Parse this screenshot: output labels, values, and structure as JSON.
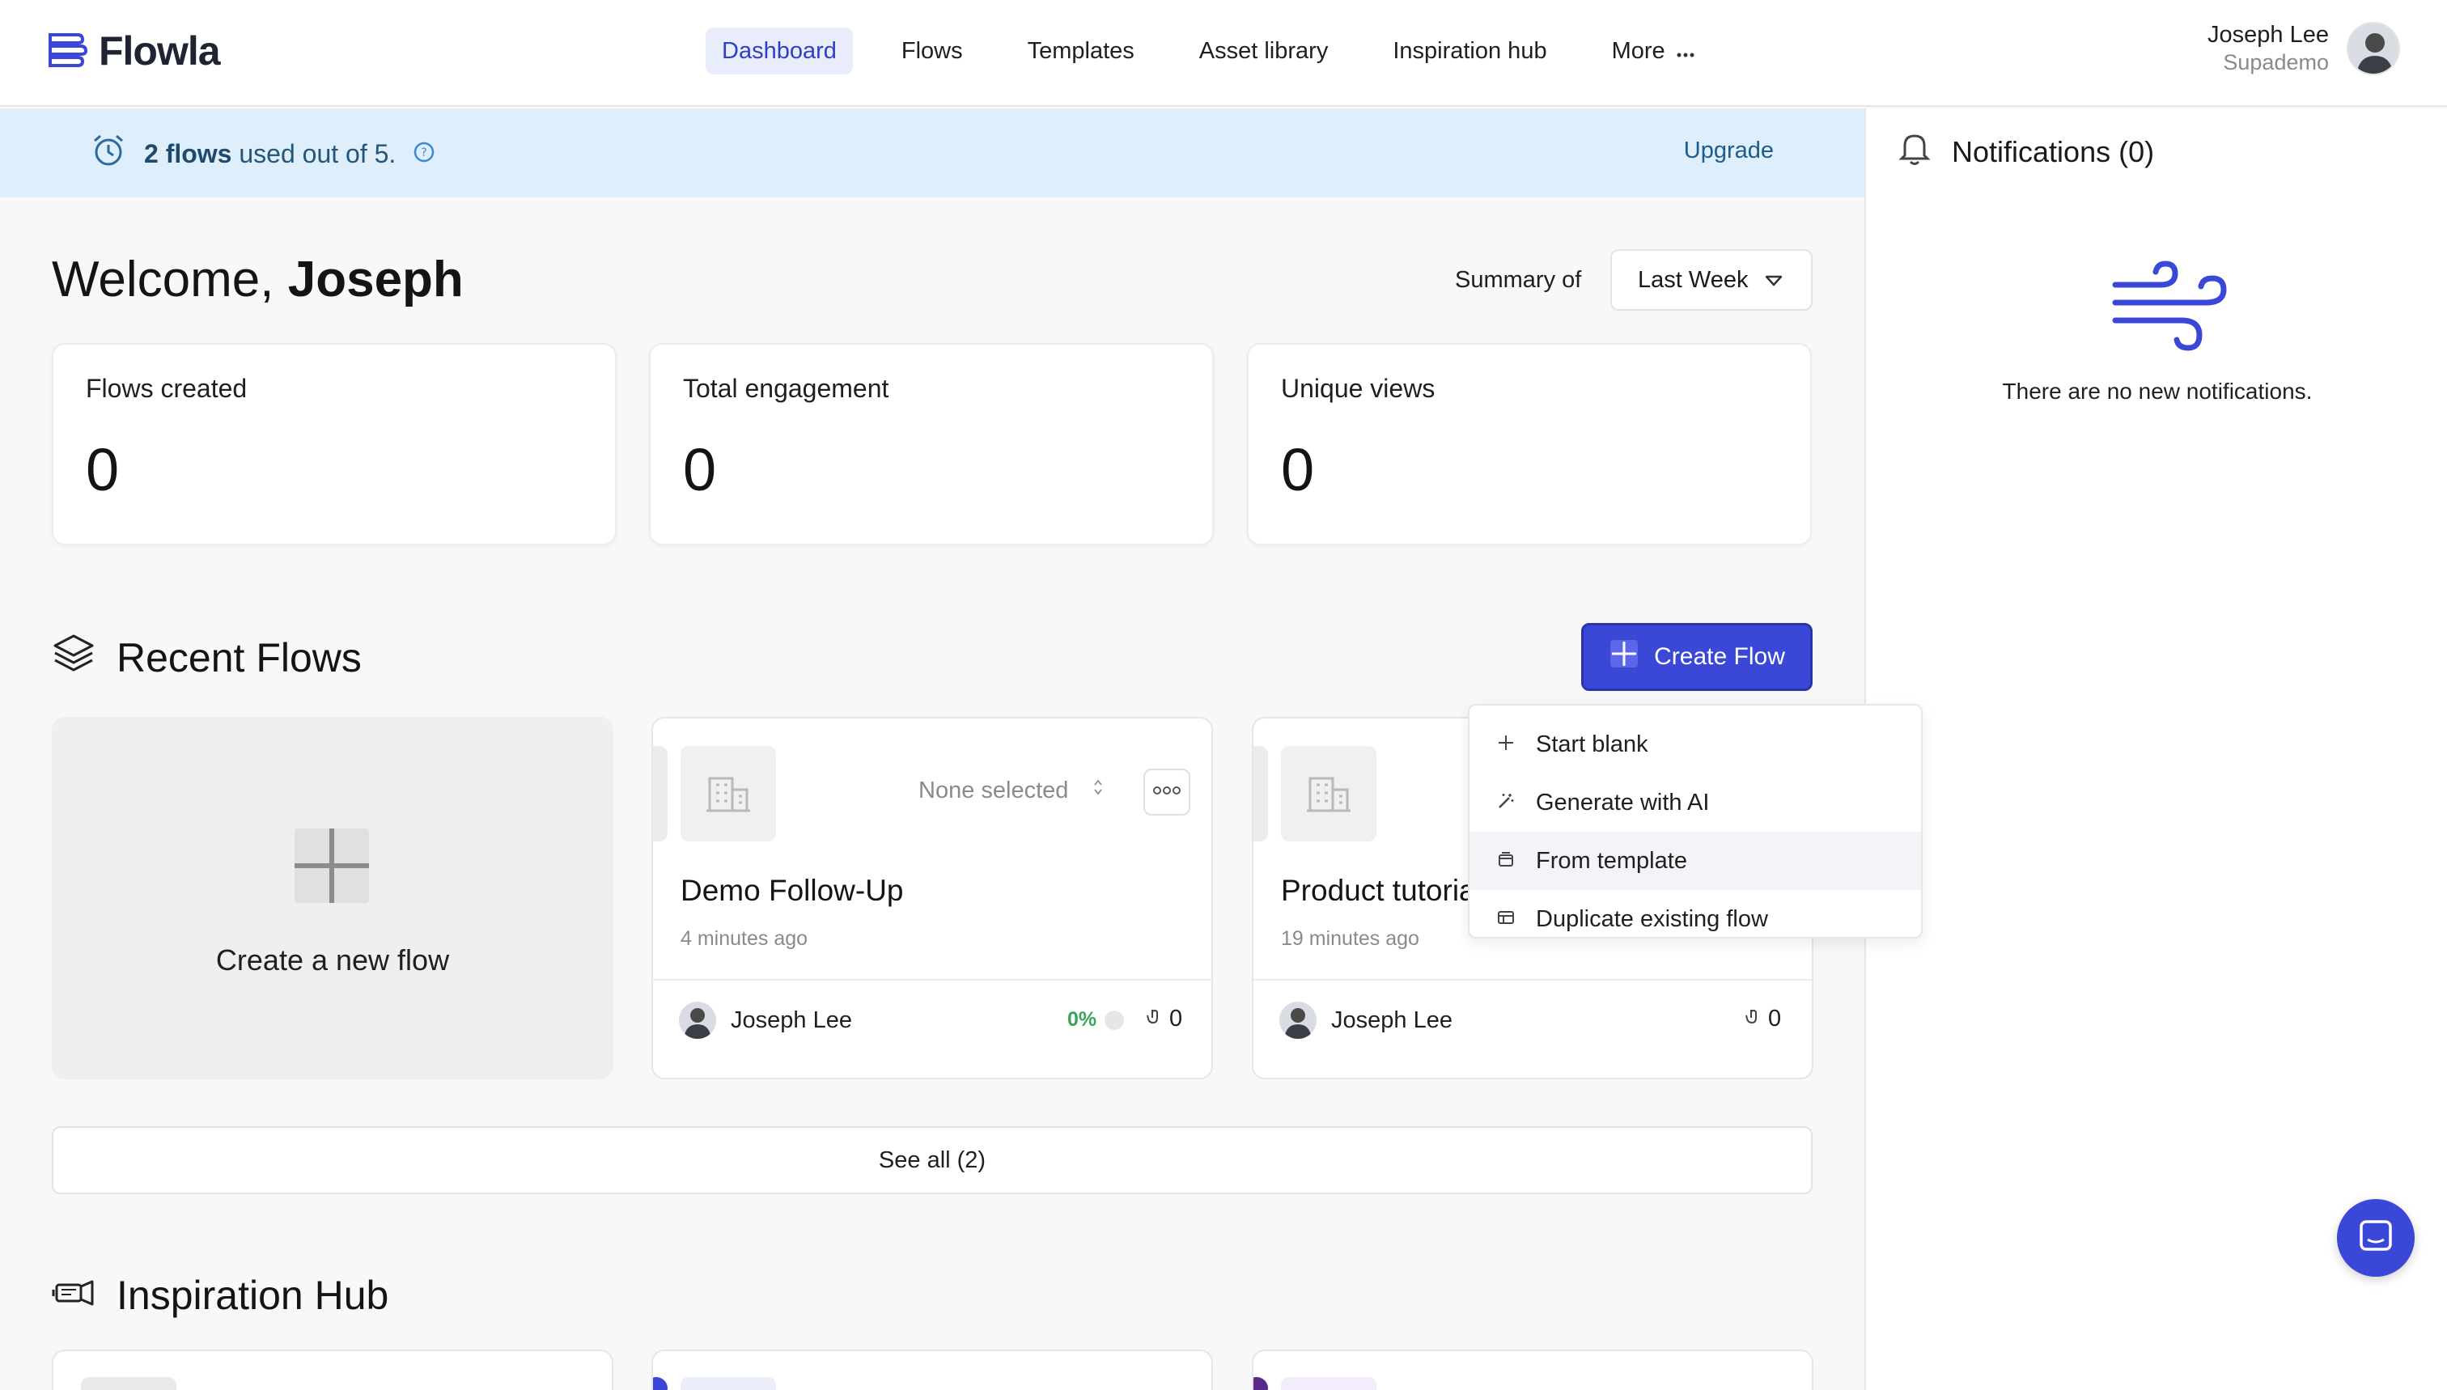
{
  "app": {
    "logo_text": "Flowla"
  },
  "nav": {
    "items": [
      {
        "label": "Dashboard",
        "active": true
      },
      {
        "label": "Flows"
      },
      {
        "label": "Templates"
      },
      {
        "label": "Asset library"
      },
      {
        "label": "Inspiration hub"
      }
    ],
    "more_label": "More"
  },
  "user": {
    "name": "Joseph Lee",
    "org": "Supademo"
  },
  "banner": {
    "used_bold": "2 flows",
    "used_rest": "used out of 5.",
    "upgrade_label": "Upgrade",
    "color": "#deeefa"
  },
  "notifications": {
    "title": "Notifications (0)",
    "empty_text": "There are no new notifications."
  },
  "welcome": {
    "greeting": "Welcome,",
    "name": "Joseph"
  },
  "summary": {
    "label": "Summary of",
    "selected": "Last Week"
  },
  "stats": [
    {
      "label": "Flows created",
      "value": "0"
    },
    {
      "label": "Total engagement",
      "value": "0"
    },
    {
      "label": "Unique views",
      "value": "0"
    }
  ],
  "recent_flows": {
    "title": "Recent Flows",
    "create_button": "Create Flow",
    "new_flow_label": "Create a new flow",
    "cards": [
      {
        "title": "Demo Follow-Up",
        "time": "4 minutes ago",
        "select_placeholder": "None selected",
        "owner": "Joseph Lee",
        "percent": "0%",
        "engagement": "0"
      },
      {
        "title": "Product tutorial",
        "time": "19 minutes ago",
        "owner": "Joseph Lee",
        "engagement": "0"
      }
    ],
    "see_all": "See all (2)"
  },
  "create_menu": {
    "items": [
      {
        "label": "Start blank",
        "icon": "plus-icon"
      },
      {
        "label": "Generate with AI",
        "icon": "magic-wand-icon"
      },
      {
        "label": "From template",
        "icon": "template-icon",
        "hover": true
      },
      {
        "label": "Duplicate existing flow",
        "icon": "duplicate-icon"
      }
    ]
  },
  "inspiration": {
    "title": "Inspiration Hub"
  },
  "colors": {
    "accent": "#3b47d6",
    "nav_active_bg": "#e9ecfb",
    "nav_active_text": "#2f3fc4",
    "success": "#3aa35c"
  }
}
